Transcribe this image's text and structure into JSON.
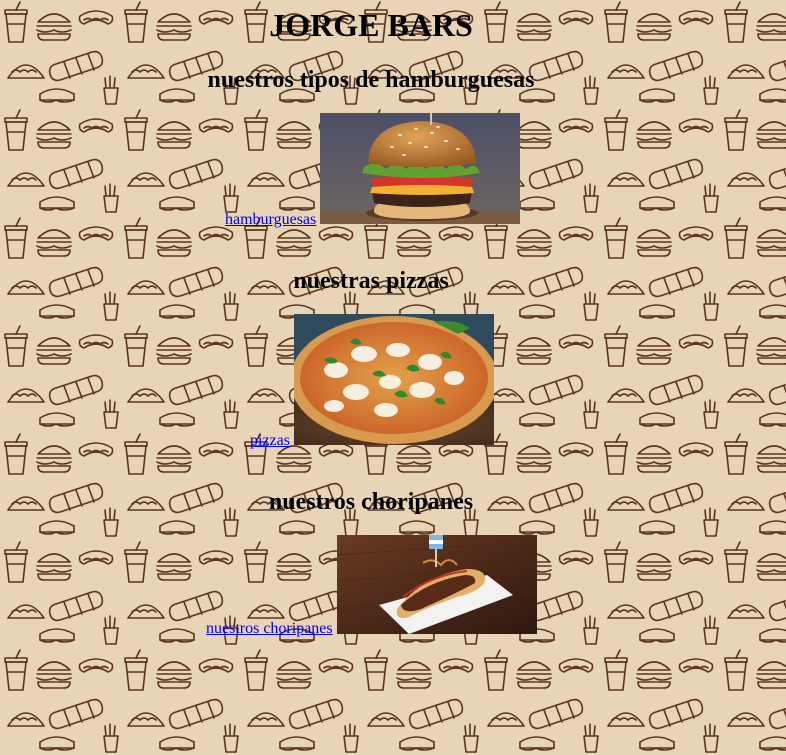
{
  "header": {
    "title": "JORGE BARS"
  },
  "sections": [
    {
      "heading": "nuestros tipos de hamburguesas",
      "link_text": "hamburguesas",
      "image_icon": "hamburger-photo"
    },
    {
      "heading": "nuestras pizzas",
      "link_text": "pizzas",
      "image_icon": "pizza-photo"
    },
    {
      "heading": "nuestros choripanes",
      "link_text": "nuestros choripanes",
      "image_icon": "choripan-photo"
    }
  ],
  "colors": {
    "background": "#e8d4b6",
    "pattern_stroke": "#5a3322",
    "link": "#0000ee"
  }
}
